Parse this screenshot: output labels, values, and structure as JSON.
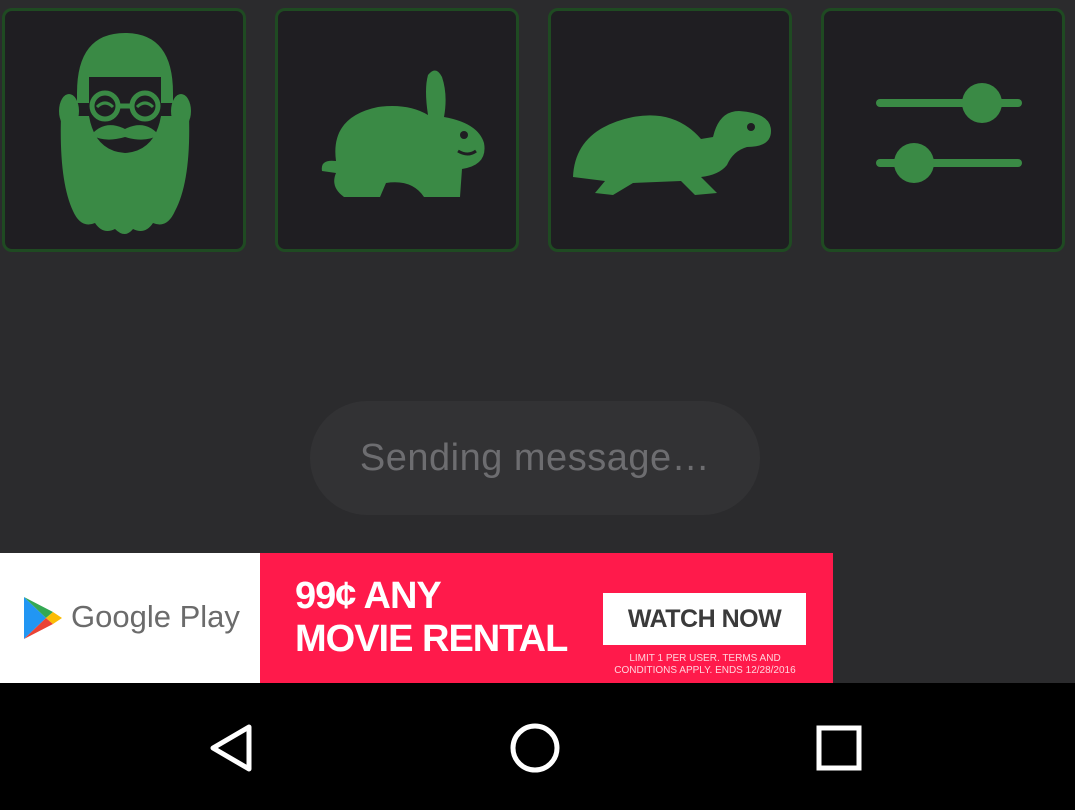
{
  "tiles": [
    {
      "icon": "bearded-man-icon"
    },
    {
      "icon": "rabbit-icon"
    },
    {
      "icon": "turtle-icon"
    },
    {
      "icon": "sliders-icon"
    }
  ],
  "status": {
    "text": "Sending message…"
  },
  "ad": {
    "brand": "Google Play",
    "headline_line1": "99¢ ANY",
    "headline_line2": "MOVIE RENTAL",
    "cta": "WATCH NOW",
    "fineprint_line1": "LIMIT 1 PER USER. TERMS AND",
    "fineprint_line2": "CONDITIONS APPLY. ENDS 12/28/2016"
  },
  "navbar": {
    "back": "back-icon",
    "home": "home-icon",
    "recents": "recents-icon"
  },
  "colors": {
    "background": "#2b2b2d",
    "tile_bg": "#1f1e22",
    "tile_border": "#1f4a22",
    "icon_green": "#3a8a45",
    "ad_red": "#ff1a4b"
  }
}
